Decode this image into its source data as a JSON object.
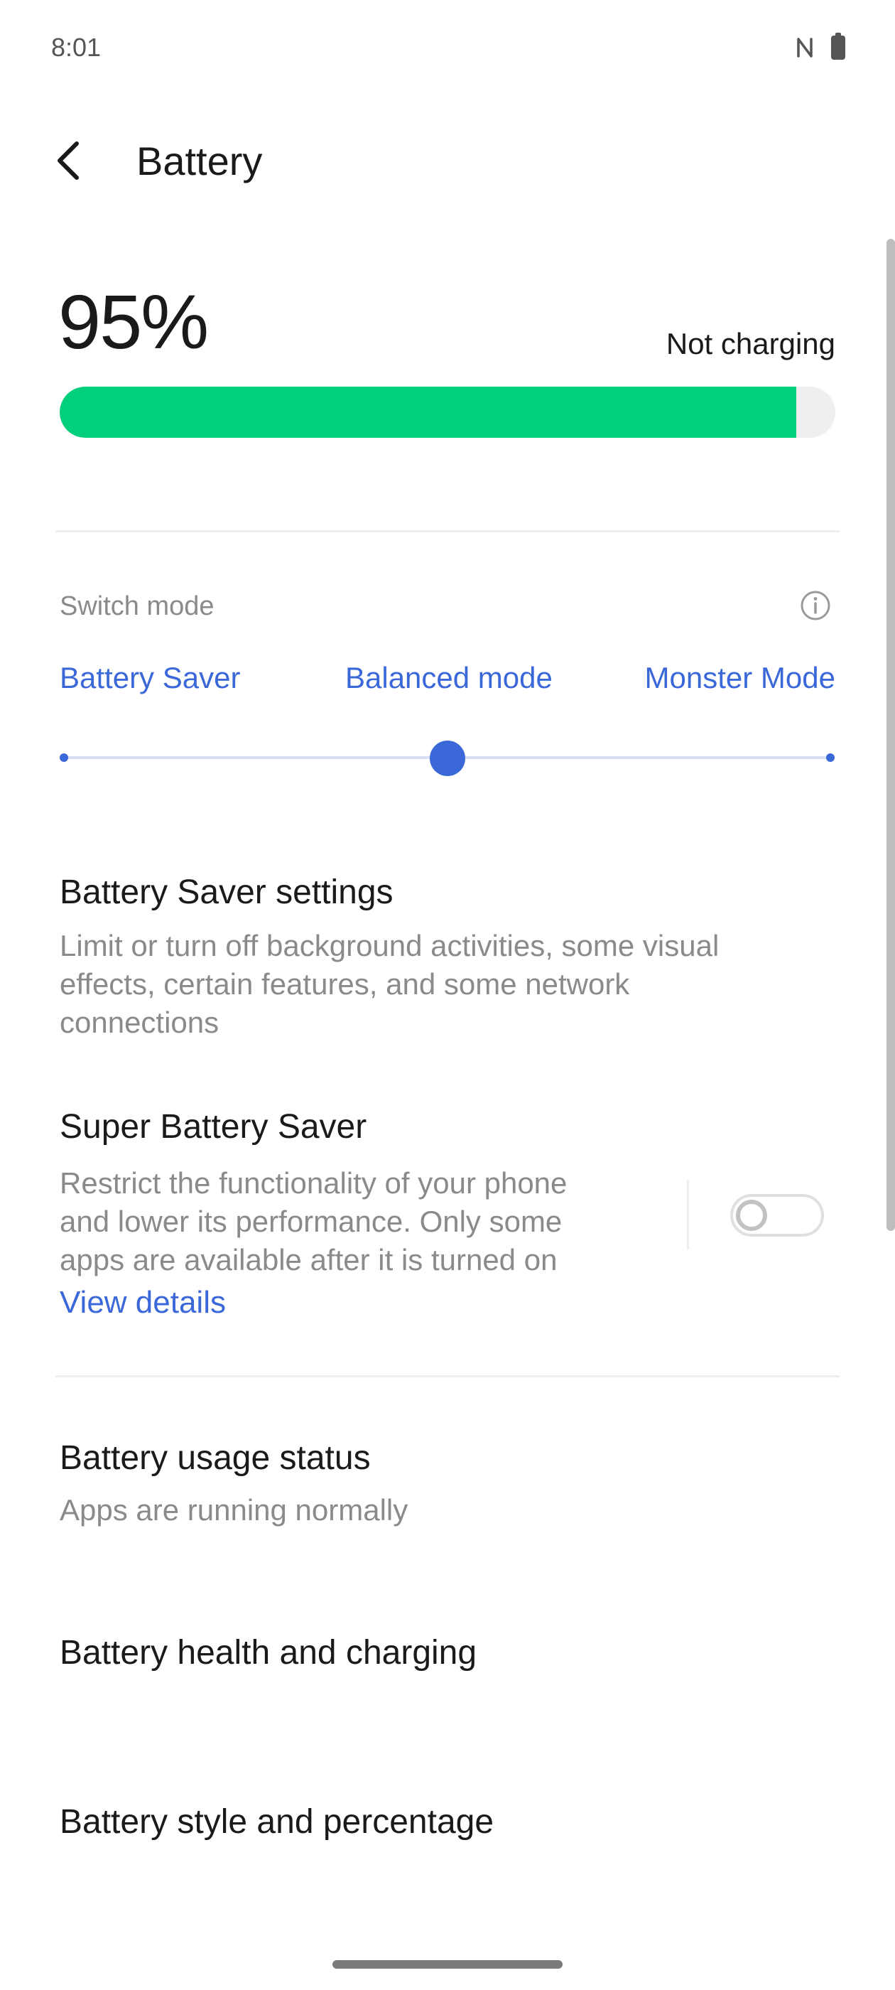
{
  "status_bar": {
    "time": "8:01",
    "icons": [
      "nfc-icon",
      "battery-icon"
    ]
  },
  "header": {
    "title": "Battery",
    "back_icon": "chevron-left-icon"
  },
  "battery": {
    "percent_text": "95%",
    "level_percent": 95,
    "charging_status": "Not charging",
    "bar_color": "#02cf7b"
  },
  "switch_mode": {
    "label": "Switch mode",
    "info_icon": "info-icon",
    "modes": [
      "Battery Saver",
      "Balanced mode",
      "Monster Mode"
    ],
    "selected_index": 1,
    "accent_color": "#3b68d8"
  },
  "settings": {
    "battery_saver": {
      "title": "Battery Saver settings",
      "description_lines": [
        "Limit or turn off background activities, some visual",
        "effects, certain features, and some network",
        "connections"
      ]
    },
    "super_battery_saver": {
      "title": "Super Battery Saver",
      "description_lines": [
        "Restrict the functionality of your phone",
        "and lower its performance. Only some",
        "apps are available after it is turned on"
      ],
      "link": "View details",
      "enabled": false
    },
    "usage_status": {
      "title": "Battery usage status",
      "subtitle": "Apps are running normally"
    },
    "health": {
      "title": "Battery health and charging"
    },
    "style": {
      "title": "Battery style and percentage"
    }
  }
}
